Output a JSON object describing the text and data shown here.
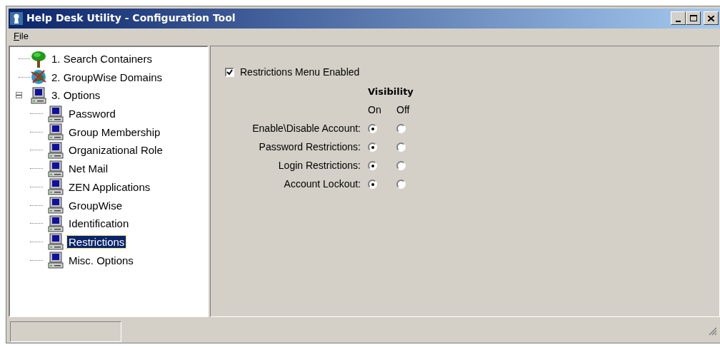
{
  "window": {
    "title": "Help Desk Utility - Configuration Tool"
  },
  "menu": [
    {
      "label": "File"
    }
  ],
  "tree": [
    {
      "label": "1. Search Containers",
      "kind": "tree",
      "selected": false
    },
    {
      "label": "2. GroupWise Domains",
      "kind": "globe",
      "selected": false
    },
    {
      "label": "3. Options",
      "kind": "computer",
      "selected": false,
      "expanded": true,
      "children": [
        {
          "label": "Password",
          "kind": "computer",
          "selected": false
        },
        {
          "label": "Group Membership",
          "kind": "computer",
          "selected": false
        },
        {
          "label": "Organizational Role",
          "kind": "computer",
          "selected": false
        },
        {
          "label": "Net Mail",
          "kind": "computer",
          "selected": false
        },
        {
          "label": "ZEN Applications",
          "kind": "computer",
          "selected": false
        },
        {
          "label": "GroupWise",
          "kind": "computer",
          "selected": false
        },
        {
          "label": "Identification",
          "kind": "computer",
          "selected": false
        },
        {
          "label": "Restrictions",
          "kind": "computer",
          "selected": true
        },
        {
          "label": "Misc. Options",
          "kind": "computer",
          "selected": false
        }
      ]
    }
  ],
  "panel": {
    "checkbox": {
      "label": "Restrictions Menu Enabled",
      "checked": true
    },
    "group_heading": "Visibility",
    "columns": [
      "On",
      "Off"
    ],
    "rows": [
      {
        "label": "Enable\\Disable Account:",
        "visible": true
      },
      {
        "label": "Password Restrictions:",
        "visible": true
      },
      {
        "label": "Login Restrictions:",
        "visible": true
      },
      {
        "label": "Account Lockout:",
        "visible": true
      }
    ]
  }
}
